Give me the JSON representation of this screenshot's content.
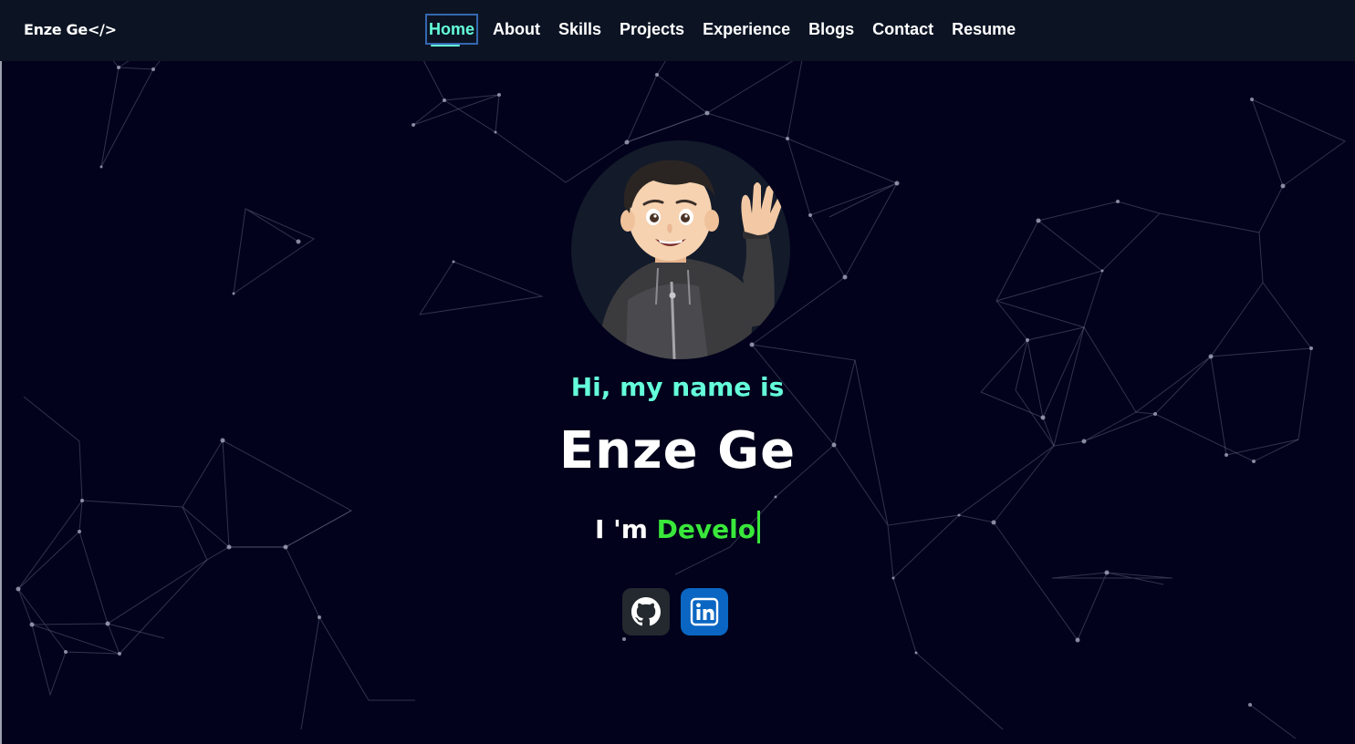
{
  "navbar": {
    "brand": "Enze Ge</>",
    "links": [
      {
        "label": "Home",
        "active": true
      },
      {
        "label": "About"
      },
      {
        "label": "Skills"
      },
      {
        "label": "Projects"
      },
      {
        "label": "Experience"
      },
      {
        "label": "Blogs"
      },
      {
        "label": "Contact"
      },
      {
        "label": "Resume"
      }
    ]
  },
  "hero": {
    "greeting": "Hi, my name is",
    "name": "Enze Ge",
    "role_prefix": "I 'm ",
    "role_typed": "Develo",
    "avatar": "memoji-waving-avatar"
  },
  "socials": [
    {
      "icon": "github-icon"
    },
    {
      "icon": "linkedin-icon"
    }
  ],
  "colors": {
    "background": "#02021c",
    "navbar": "#0c1424",
    "accent": "#64ffda",
    "typed_role": "#39e83a",
    "github": "#24292f",
    "linkedin": "#0a66c2"
  }
}
